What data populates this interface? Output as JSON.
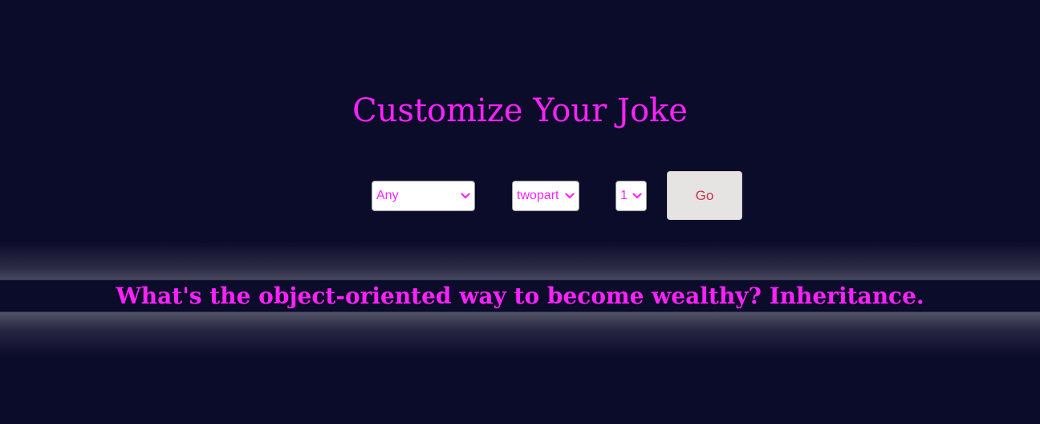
{
  "title": "Customize Your Joke",
  "controls": {
    "category": {
      "selected": "Any"
    },
    "type": {
      "selected": "twopart"
    },
    "amount": {
      "selected": "1"
    },
    "go_label": "Go"
  },
  "joke": {
    "text": "What's the object-oriented way to become wealthy? Inheritance."
  },
  "colors": {
    "background": "#0b0b2a",
    "accent": "#ff22ff",
    "button_text": "#c2364a",
    "button_bg": "#e6e3e3"
  },
  "icons": {
    "dropdown": "chevron-down-icon"
  }
}
